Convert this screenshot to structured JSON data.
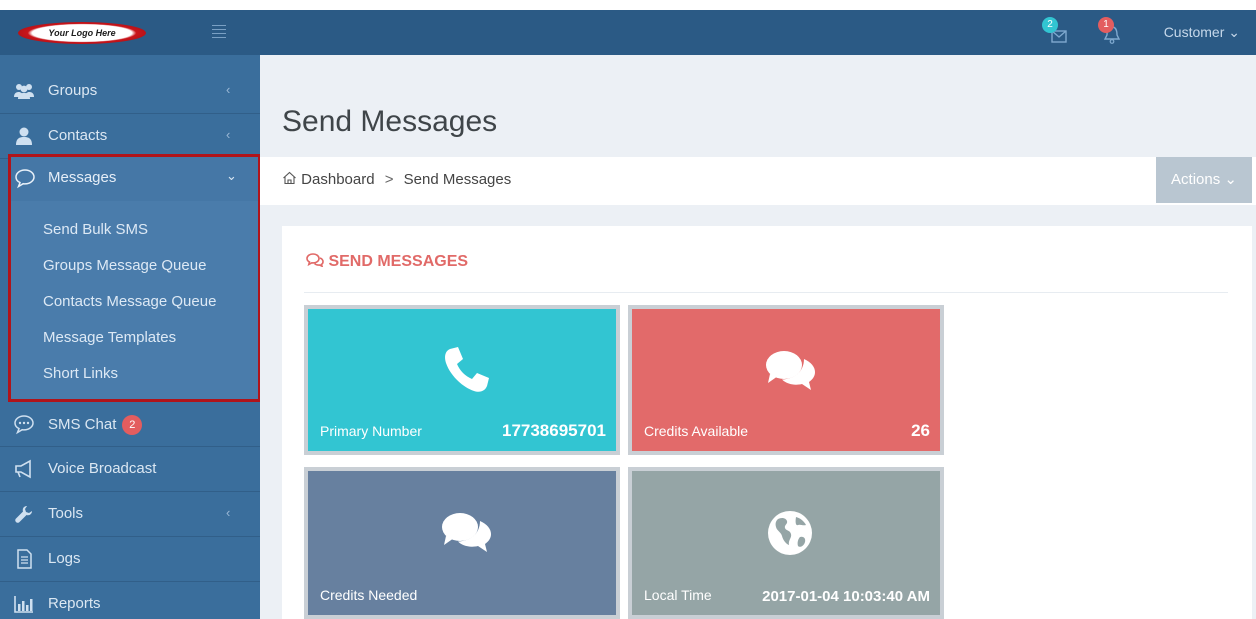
{
  "header": {
    "logo_text": "Your Logo Here",
    "messages_badge": "2",
    "notifications_badge": "1",
    "user_menu": "Customer ⌄"
  },
  "sidebar": {
    "items": [
      {
        "label": "Groups"
      },
      {
        "label": "Contacts"
      },
      {
        "label": "Messages"
      },
      {
        "label": "SMS Chat",
        "badge": "2"
      },
      {
        "label": "Voice Broadcast"
      },
      {
        "label": "Tools"
      },
      {
        "label": "Logs"
      },
      {
        "label": "Reports"
      }
    ],
    "messages_sub": [
      {
        "label": "Send Bulk SMS"
      },
      {
        "label": "Groups Message Queue"
      },
      {
        "label": "Contacts Message Queue"
      },
      {
        "label": "Message Templates"
      },
      {
        "label": "Short Links"
      }
    ]
  },
  "main": {
    "title": "Send Messages",
    "breadcrumb": {
      "home": "Dashboard",
      "sep": ">",
      "current": "Send Messages"
    },
    "actions_label": "Actions ⌄",
    "card_title": "SEND MESSAGES",
    "tiles": [
      {
        "label": "Primary Number",
        "value": "17738695701",
        "color": "#32c5d2"
      },
      {
        "label": "Credits Available",
        "value": "26",
        "color": "#e26a6a"
      },
      {
        "label": "Credits Needed",
        "value": "",
        "color": "#67809f"
      },
      {
        "label": "Local Time",
        "value": "2017-01-04 10:03:40 AM",
        "color": "#95a5a6"
      }
    ]
  },
  "colors": {
    "header": "#2b5a85",
    "sidebar": "#3a6e9c",
    "highlight_frame": "#b0141a",
    "accent": "#e16a68"
  }
}
